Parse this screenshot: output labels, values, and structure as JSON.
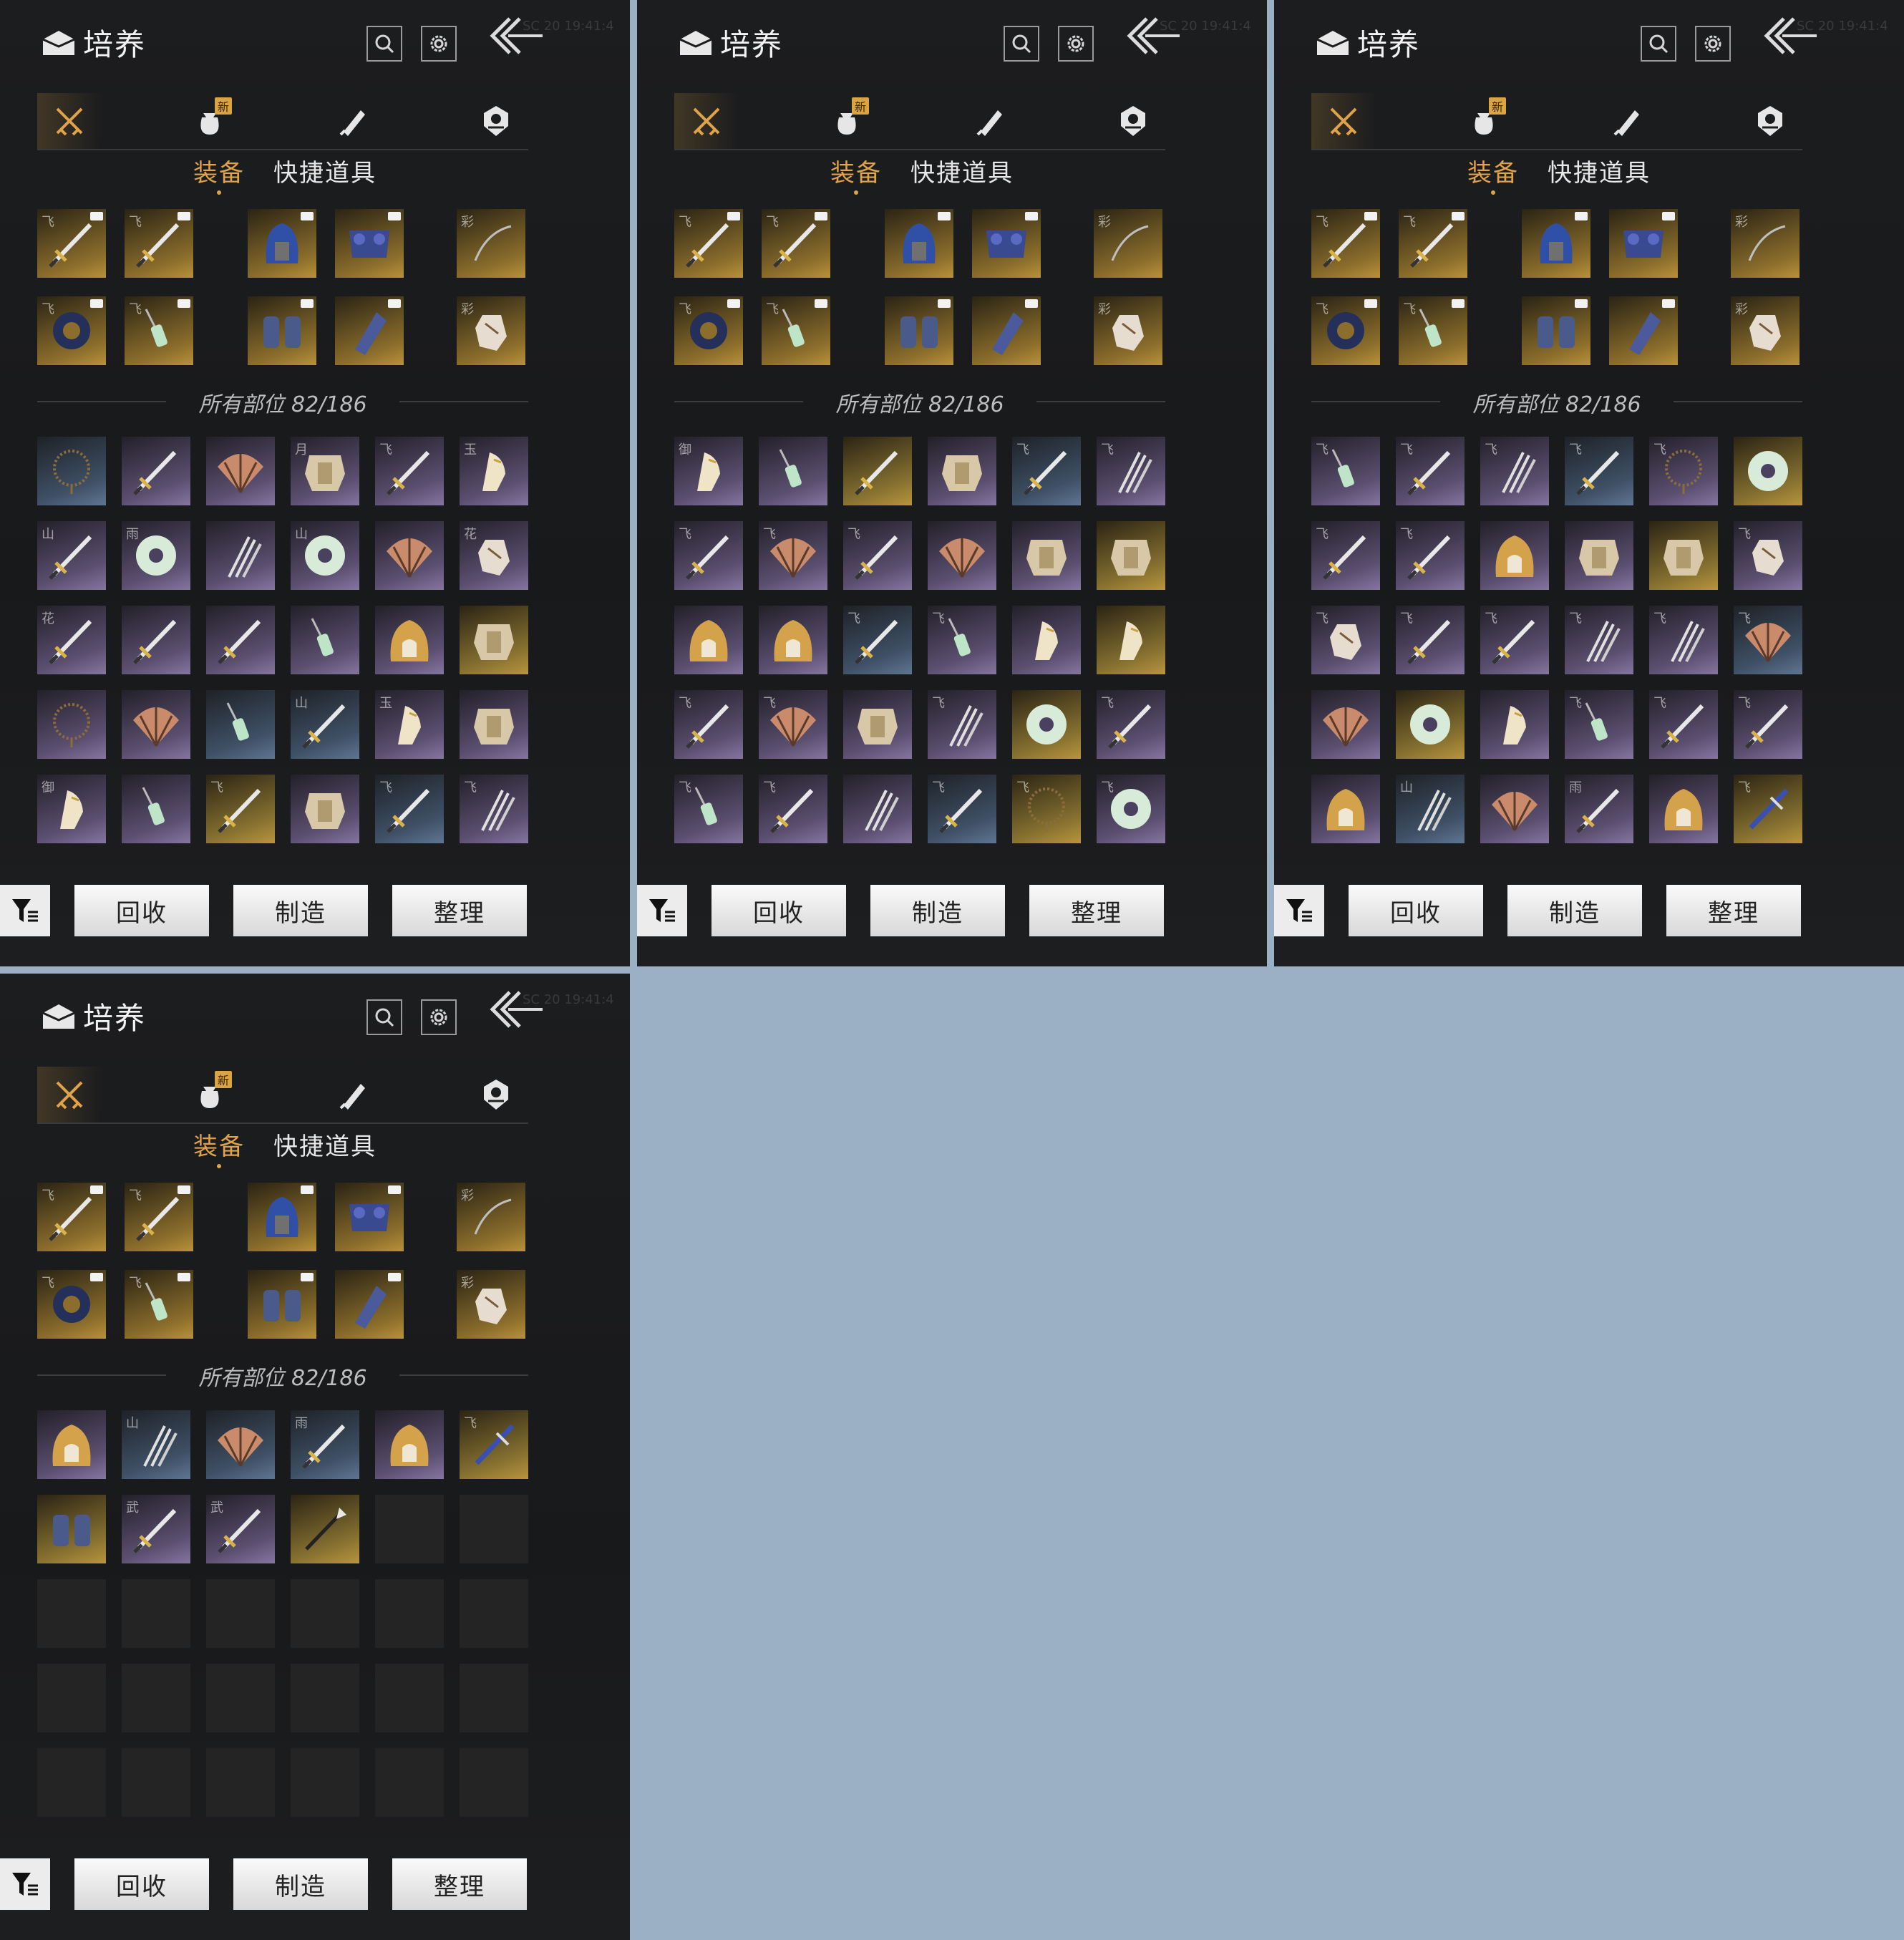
{
  "header": {
    "title": "培养",
    "timestamp": "SC 20 19:41:4"
  },
  "category_tabs": [
    {
      "icon": "crossed-swords-icon",
      "active": true
    },
    {
      "icon": "pouch-icon",
      "badge": "新"
    },
    {
      "icon": "scroll-icon"
    },
    {
      "icon": "emblem-icon"
    }
  ],
  "sub_tabs": [
    {
      "label": "装备",
      "active": true
    },
    {
      "label": "快捷道具"
    }
  ],
  "counter": "所有部位 82/186",
  "buttons": {
    "recycle": "回收",
    "craft": "制造",
    "sort": "整理"
  },
  "equipped": [
    {
      "mark": "飞",
      "item": "sword"
    },
    {
      "mark": "飞",
      "item": "sword"
    },
    {
      "mark": "",
      "item": "blue-helmet"
    },
    {
      "mark": "",
      "item": "blue-armor"
    },
    {
      "mark": "彩",
      "item": "whip"
    },
    {
      "mark": "飞",
      "item": "ring"
    },
    {
      "mark": "飞",
      "item": "tassel"
    },
    {
      "mark": "",
      "item": "gauntlets"
    },
    {
      "mark": "",
      "item": "bracer"
    },
    {
      "mark": "彩",
      "item": "charm"
    }
  ],
  "panels": [
    {
      "inventory": [
        {
          "mark": "",
          "r": "blue",
          "item": "beads"
        },
        {
          "mark": "",
          "r": "purple",
          "item": "sword"
        },
        {
          "mark": "",
          "r": "purple",
          "item": "fan"
        },
        {
          "mark": "月",
          "r": "purple",
          "item": "armor"
        },
        {
          "mark": "飞",
          "r": "purple",
          "item": "sword"
        },
        {
          "mark": "玉",
          "r": "purple",
          "item": "claw"
        },
        {
          "mark": "山",
          "r": "purple",
          "item": "sword"
        },
        {
          "mark": "雨",
          "r": "purple",
          "item": "jade"
        },
        {
          "mark": "",
          "r": "purple",
          "item": "fork"
        },
        {
          "mark": "山",
          "r": "purple",
          "item": "jade"
        },
        {
          "mark": "",
          "r": "purple",
          "item": "fan"
        },
        {
          "mark": "花",
          "r": "purple",
          "item": "charm"
        },
        {
          "mark": "花",
          "r": "purple",
          "item": "sword"
        },
        {
          "mark": "",
          "r": "purple",
          "item": "sword"
        },
        {
          "mark": "",
          "r": "purple",
          "item": "sword"
        },
        {
          "mark": "",
          "r": "purple",
          "item": "tassel"
        },
        {
          "mark": "",
          "r": "purple",
          "item": "hood"
        },
        {
          "mark": "",
          "r": "gold",
          "item": "armor"
        },
        {
          "mark": "",
          "r": "purple",
          "item": "beads"
        },
        {
          "mark": "",
          "r": "purple",
          "item": "fan"
        },
        {
          "mark": "",
          "r": "blue",
          "item": "tassel"
        },
        {
          "mark": "山",
          "r": "blue",
          "item": "sword"
        },
        {
          "mark": "玉",
          "r": "purple",
          "item": "claw"
        },
        {
          "mark": "",
          "r": "purple",
          "item": "armor"
        },
        {
          "mark": "御",
          "r": "purple",
          "item": "claw"
        },
        {
          "mark": "",
          "r": "purple",
          "item": "tassel"
        },
        {
          "mark": "飞",
          "r": "gold",
          "item": "sword"
        },
        {
          "mark": "",
          "r": "purple",
          "item": "armor"
        },
        {
          "mark": "飞",
          "r": "blue",
          "item": "sword"
        },
        {
          "mark": "飞",
          "r": "purple",
          "item": "fork"
        }
      ]
    },
    {
      "inventory": [
        {
          "mark": "御",
          "r": "purple",
          "item": "claw"
        },
        {
          "mark": "",
          "r": "purple",
          "item": "tassel"
        },
        {
          "mark": "",
          "r": "gold",
          "item": "sword"
        },
        {
          "mark": "",
          "r": "purple",
          "item": "armor"
        },
        {
          "mark": "飞",
          "r": "blue",
          "item": "sword"
        },
        {
          "mark": "飞",
          "r": "purple",
          "item": "fork"
        },
        {
          "mark": "飞",
          "r": "purple",
          "item": "sword"
        },
        {
          "mark": "飞",
          "r": "purple",
          "item": "fan"
        },
        {
          "mark": "飞",
          "r": "purple",
          "item": "sword"
        },
        {
          "mark": "",
          "r": "purple",
          "item": "fan"
        },
        {
          "mark": "",
          "r": "purple",
          "item": "armor"
        },
        {
          "mark": "",
          "r": "gold",
          "item": "armor"
        },
        {
          "mark": "",
          "r": "purple",
          "item": "hood"
        },
        {
          "mark": "",
          "r": "purple",
          "item": "hood"
        },
        {
          "mark": "飞",
          "r": "blue",
          "item": "sword"
        },
        {
          "mark": "飞",
          "r": "purple",
          "item": "tassel"
        },
        {
          "mark": "",
          "r": "purple",
          "item": "claw"
        },
        {
          "mark": "",
          "r": "gold",
          "item": "claw"
        },
        {
          "mark": "飞",
          "r": "purple",
          "item": "sword"
        },
        {
          "mark": "飞",
          "r": "purple",
          "item": "fan"
        },
        {
          "mark": "",
          "r": "purple",
          "item": "armor"
        },
        {
          "mark": "飞",
          "r": "purple",
          "item": "fork"
        },
        {
          "mark": "",
          "r": "gold",
          "item": "jade"
        },
        {
          "mark": "飞",
          "r": "purple",
          "item": "sword"
        },
        {
          "mark": "飞",
          "r": "purple",
          "item": "tassel"
        },
        {
          "mark": "飞",
          "r": "purple",
          "item": "sword"
        },
        {
          "mark": "",
          "r": "purple",
          "item": "fork"
        },
        {
          "mark": "飞",
          "r": "blue",
          "item": "sword"
        },
        {
          "mark": "飞",
          "r": "gold",
          "item": "beads"
        },
        {
          "mark": "飞",
          "r": "purple",
          "item": "jade"
        }
      ]
    },
    {
      "inventory": [
        {
          "mark": "飞",
          "r": "purple",
          "item": "tassel"
        },
        {
          "mark": "飞",
          "r": "purple",
          "item": "sword"
        },
        {
          "mark": "飞",
          "r": "purple",
          "item": "fork"
        },
        {
          "mark": "飞",
          "r": "blue",
          "item": "sword"
        },
        {
          "mark": "飞",
          "r": "purple",
          "item": "beads"
        },
        {
          "mark": "",
          "r": "gold",
          "item": "jade"
        },
        {
          "mark": "飞",
          "r": "purple",
          "item": "sword"
        },
        {
          "mark": "飞",
          "r": "purple",
          "item": "sword"
        },
        {
          "mark": "",
          "r": "purple",
          "item": "hood"
        },
        {
          "mark": "",
          "r": "purple",
          "item": "armor"
        },
        {
          "mark": "",
          "r": "gold",
          "item": "armor"
        },
        {
          "mark": "飞",
          "r": "purple",
          "item": "charm"
        },
        {
          "mark": "飞",
          "r": "purple",
          "item": "charm"
        },
        {
          "mark": "飞",
          "r": "purple",
          "item": "sword"
        },
        {
          "mark": "飞",
          "r": "purple",
          "item": "sword"
        },
        {
          "mark": "飞",
          "r": "purple",
          "item": "fork"
        },
        {
          "mark": "飞",
          "r": "purple",
          "item": "fork"
        },
        {
          "mark": "飞",
          "r": "blue",
          "item": "fan"
        },
        {
          "mark": "",
          "r": "purple",
          "item": "fan"
        },
        {
          "mark": "",
          "r": "gold",
          "item": "jade"
        },
        {
          "mark": "",
          "r": "purple",
          "item": "claw"
        },
        {
          "mark": "飞",
          "r": "purple",
          "item": "tassel"
        },
        {
          "mark": "飞",
          "r": "purple",
          "item": "sword"
        },
        {
          "mark": "飞",
          "r": "purple",
          "item": "sword"
        },
        {
          "mark": "",
          "r": "purple",
          "item": "hood"
        },
        {
          "mark": "山",
          "r": "blue",
          "item": "fork"
        },
        {
          "mark": "",
          "r": "purple",
          "item": "fan"
        },
        {
          "mark": "雨",
          "r": "purple",
          "item": "sword"
        },
        {
          "mark": "",
          "r": "purple",
          "item": "hood"
        },
        {
          "mark": "飞",
          "r": "gold",
          "item": "blue-spear"
        }
      ]
    },
    {
      "inventory": [
        {
          "mark": "",
          "r": "purple",
          "item": "hood"
        },
        {
          "mark": "山",
          "r": "blue",
          "item": "fork"
        },
        {
          "mark": "",
          "r": "blue",
          "item": "fan"
        },
        {
          "mark": "雨",
          "r": "blue",
          "item": "sword"
        },
        {
          "mark": "",
          "r": "purple",
          "item": "hood"
        },
        {
          "mark": "飞",
          "r": "gold",
          "item": "blue-spear"
        },
        {
          "mark": "",
          "r": "gold",
          "item": "gauntlets"
        },
        {
          "mark": "武",
          "r": "purple",
          "item": "sword"
        },
        {
          "mark": "武",
          "r": "purple",
          "item": "sword"
        },
        {
          "mark": "",
          "r": "gold",
          "item": "spear"
        },
        {
          "mark": "",
          "r": "empty",
          "item": ""
        },
        {
          "mark": "",
          "r": "empty",
          "item": ""
        },
        {
          "mark": "",
          "r": "empty",
          "item": ""
        },
        {
          "mark": "",
          "r": "empty",
          "item": ""
        },
        {
          "mark": "",
          "r": "empty",
          "item": ""
        },
        {
          "mark": "",
          "r": "empty",
          "item": ""
        },
        {
          "mark": "",
          "r": "empty",
          "item": ""
        },
        {
          "mark": "",
          "r": "empty",
          "item": ""
        },
        {
          "mark": "",
          "r": "empty",
          "item": ""
        },
        {
          "mark": "",
          "r": "empty",
          "item": ""
        },
        {
          "mark": "",
          "r": "empty",
          "item": ""
        },
        {
          "mark": "",
          "r": "empty",
          "item": ""
        },
        {
          "mark": "",
          "r": "empty",
          "item": ""
        },
        {
          "mark": "",
          "r": "empty",
          "item": ""
        },
        {
          "mark": "",
          "r": "empty",
          "item": ""
        },
        {
          "mark": "",
          "r": "empty",
          "item": ""
        },
        {
          "mark": "",
          "r": "empty",
          "item": ""
        },
        {
          "mark": "",
          "r": "empty",
          "item": ""
        },
        {
          "mark": "",
          "r": "empty",
          "item": ""
        },
        {
          "mark": "",
          "r": "empty",
          "item": ""
        }
      ]
    }
  ]
}
